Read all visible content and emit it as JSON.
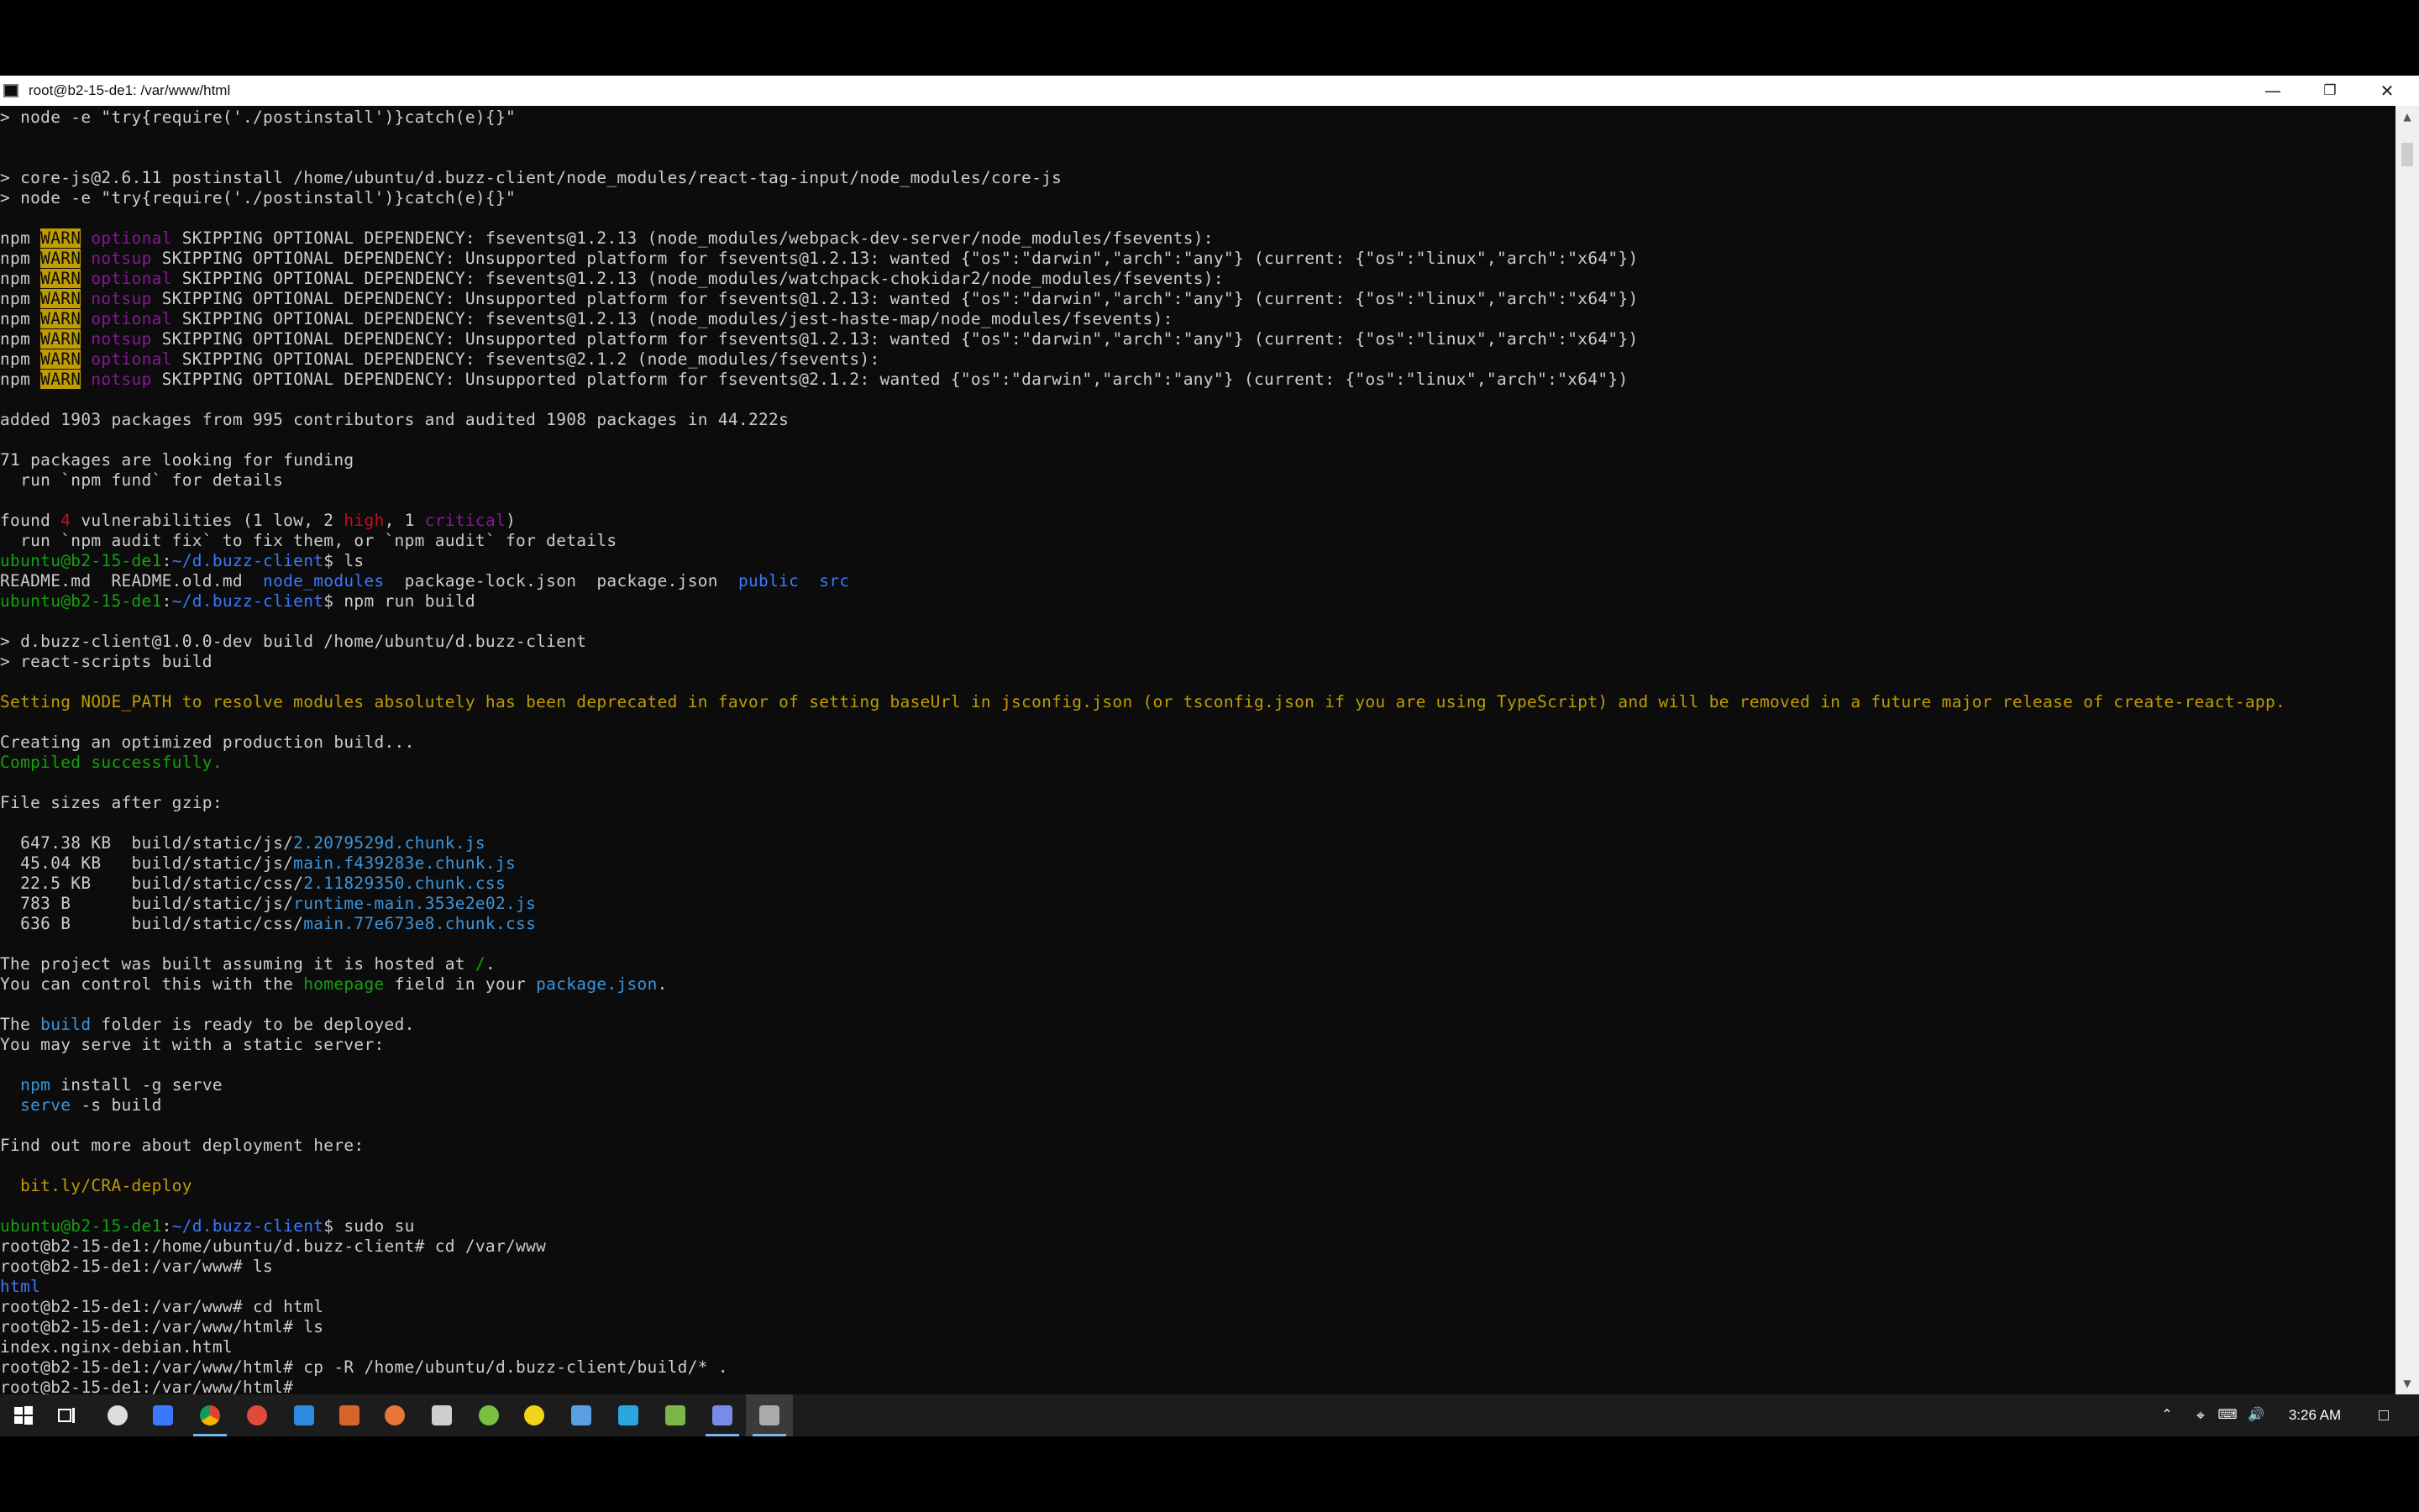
{
  "window": {
    "title": "root@b2-15-de1: /var/www/html",
    "icon": "terminal-icon"
  },
  "colors": {
    "default": "#cccccc",
    "warn_bg": "#c19c00",
    "warn_fg": "#0c0c0c",
    "optional": "#881798",
    "notsup": "#881798",
    "blue": "#3b78ff",
    "green": "#13a10e",
    "yellow": "#c19c00",
    "red": "#c50f1f",
    "cyan": "#3a96dd"
  },
  "terminal": {
    "lines": [
      [
        [
          "> node -e \"try{require('./postinstall')}catch(e){}\"",
          "d"
        ]
      ],
      [
        [
          "",
          "d"
        ]
      ],
      [
        [
          "",
          "d"
        ]
      ],
      [
        [
          "> core-js@2.6.11 postinstall /home/ubuntu/d.buzz-client/node_modules/react-tag-input/node_modules/core-js",
          "d"
        ]
      ],
      [
        [
          "> node -e \"try{require('./postinstall')}catch(e){}\"",
          "d"
        ]
      ],
      [
        [
          "",
          "d"
        ]
      ],
      [
        [
          "npm ",
          "d"
        ],
        [
          "WARN",
          "warn"
        ],
        [
          " ",
          "d"
        ],
        [
          "optional",
          "opt"
        ],
        [
          " SKIPPING OPTIONAL DEPENDENCY: fsevents@1.2.13 (node_modules/webpack-dev-server/node_modules/fsevents):",
          "d"
        ]
      ],
      [
        [
          "npm ",
          "d"
        ],
        [
          "WARN",
          "warn"
        ],
        [
          " ",
          "d"
        ],
        [
          "notsup",
          "opt"
        ],
        [
          " SKIPPING OPTIONAL DEPENDENCY: Unsupported platform for fsevents@1.2.13: wanted {\"os\":\"darwin\",\"arch\":\"any\"} (current: {\"os\":\"linux\",\"arch\":\"x64\"})",
          "d"
        ]
      ],
      [
        [
          "npm ",
          "d"
        ],
        [
          "WARN",
          "warn"
        ],
        [
          " ",
          "d"
        ],
        [
          "optional",
          "opt"
        ],
        [
          " SKIPPING OPTIONAL DEPENDENCY: fsevents@1.2.13 (node_modules/watchpack-chokidar2/node_modules/fsevents):",
          "d"
        ]
      ],
      [
        [
          "npm ",
          "d"
        ],
        [
          "WARN",
          "warn"
        ],
        [
          " ",
          "d"
        ],
        [
          "notsup",
          "opt"
        ],
        [
          " SKIPPING OPTIONAL DEPENDENCY: Unsupported platform for fsevents@1.2.13: wanted {\"os\":\"darwin\",\"arch\":\"any\"} (current: {\"os\":\"linux\",\"arch\":\"x64\"})",
          "d"
        ]
      ],
      [
        [
          "npm ",
          "d"
        ],
        [
          "WARN",
          "warn"
        ],
        [
          " ",
          "d"
        ],
        [
          "optional",
          "opt"
        ],
        [
          " SKIPPING OPTIONAL DEPENDENCY: fsevents@1.2.13 (node_modules/jest-haste-map/node_modules/fsevents):",
          "d"
        ]
      ],
      [
        [
          "npm ",
          "d"
        ],
        [
          "WARN",
          "warn"
        ],
        [
          " ",
          "d"
        ],
        [
          "notsup",
          "opt"
        ],
        [
          " SKIPPING OPTIONAL DEPENDENCY: Unsupported platform for fsevents@1.2.13: wanted {\"os\":\"darwin\",\"arch\":\"any\"} (current: {\"os\":\"linux\",\"arch\":\"x64\"})",
          "d"
        ]
      ],
      [
        [
          "npm ",
          "d"
        ],
        [
          "WARN",
          "warn"
        ],
        [
          " ",
          "d"
        ],
        [
          "optional",
          "opt"
        ],
        [
          " SKIPPING OPTIONAL DEPENDENCY: fsevents@2.1.2 (node_modules/fsevents):",
          "d"
        ]
      ],
      [
        [
          "npm ",
          "d"
        ],
        [
          "WARN",
          "warn"
        ],
        [
          " ",
          "d"
        ],
        [
          "notsup",
          "opt"
        ],
        [
          " SKIPPING OPTIONAL DEPENDENCY: Unsupported platform for fsevents@2.1.2: wanted {\"os\":\"darwin\",\"arch\":\"any\"} (current: {\"os\":\"linux\",\"arch\":\"x64\"})",
          "d"
        ]
      ],
      [
        [
          "",
          "d"
        ]
      ],
      [
        [
          "added 1903 packages from 995 contributors and audited 1908 packages in 44.222s",
          "d"
        ]
      ],
      [
        [
          "",
          "d"
        ]
      ],
      [
        [
          "71 packages are looking for funding",
          "d"
        ]
      ],
      [
        [
          "  run `npm fund` for details",
          "d"
        ]
      ],
      [
        [
          "",
          "d"
        ]
      ],
      [
        [
          "found ",
          "d"
        ],
        [
          "4",
          "red"
        ],
        [
          " vulnerabilities (1 low, 2 ",
          "d"
        ],
        [
          "high",
          "red"
        ],
        [
          ", 1 ",
          "d"
        ],
        [
          "critical",
          "opt"
        ],
        [
          ")",
          "d"
        ]
      ],
      [
        [
          "  run `npm audit fix` to fix them, or `npm audit` for details",
          "d"
        ]
      ],
      [
        [
          "ubuntu@b2-15-de1",
          "green"
        ],
        [
          ":",
          "d"
        ],
        [
          "~/d.buzz-client",
          "blue"
        ],
        [
          "$ ls",
          "d"
        ]
      ],
      [
        [
          "README.md  README.old.md  ",
          "d"
        ],
        [
          "node_modules",
          "blue"
        ],
        [
          "  package-lock.json  package.json  ",
          "d"
        ],
        [
          "public",
          "blue"
        ],
        [
          "  ",
          "d"
        ],
        [
          "src",
          "blue"
        ]
      ],
      [
        [
          "ubuntu@b2-15-de1",
          "green"
        ],
        [
          ":",
          "d"
        ],
        [
          "~/d.buzz-client",
          "blue"
        ],
        [
          "$ npm run build",
          "d"
        ]
      ],
      [
        [
          "",
          "d"
        ]
      ],
      [
        [
          "> d.buzz-client@1.0.0-dev build /home/ubuntu/d.buzz-client",
          "d"
        ]
      ],
      [
        [
          "> react-scripts build",
          "d"
        ]
      ],
      [
        [
          "",
          "d"
        ]
      ],
      [
        [
          "Setting NODE_PATH to resolve modules absolutely has been deprecated in favor of setting baseUrl in jsconfig.json (or tsconfig.json if you are using TypeScript) and will be removed in a future major release of create-react-app.",
          "yellow"
        ]
      ],
      [
        [
          "",
          "d"
        ]
      ],
      [
        [
          "Creating an optimized production build...",
          "d"
        ]
      ],
      [
        [
          "Compiled successfully.",
          "green"
        ]
      ],
      [
        [
          "",
          "d"
        ]
      ],
      [
        [
          "File sizes after gzip:",
          "d"
        ]
      ],
      [
        [
          "",
          "d"
        ]
      ],
      [
        [
          "  647.38 KB  build/static/js/",
          "d"
        ],
        [
          "2.2079529d.chunk.js",
          "cyan"
        ]
      ],
      [
        [
          "  45.04 KB   build/static/js/",
          "d"
        ],
        [
          "main.f439283e.chunk.js",
          "cyan"
        ]
      ],
      [
        [
          "  22.5 KB    build/static/css/",
          "d"
        ],
        [
          "2.11829350.chunk.css",
          "cyan"
        ]
      ],
      [
        [
          "  783 B      build/static/js/",
          "d"
        ],
        [
          "runtime-main.353e2e02.js",
          "cyan"
        ]
      ],
      [
        [
          "  636 B      build/static/css/",
          "d"
        ],
        [
          "main.77e673e8.chunk.css",
          "cyan"
        ]
      ],
      [
        [
          "",
          "d"
        ]
      ],
      [
        [
          "The project was built assuming it is hosted at ",
          "d"
        ],
        [
          "/",
          "green"
        ],
        [
          ".",
          "d"
        ]
      ],
      [
        [
          "You can control this with the ",
          "d"
        ],
        [
          "homepage",
          "green"
        ],
        [
          " field in your ",
          "d"
        ],
        [
          "package.json",
          "cyan"
        ],
        [
          ".",
          "d"
        ]
      ],
      [
        [
          "",
          "d"
        ]
      ],
      [
        [
          "The ",
          "d"
        ],
        [
          "build",
          "cyan"
        ],
        [
          " folder is ready to be deployed.",
          "d"
        ]
      ],
      [
        [
          "You may serve it with a static server:",
          "d"
        ]
      ],
      [
        [
          "",
          "d"
        ]
      ],
      [
        [
          "  ",
          "d"
        ],
        [
          "npm",
          "cyan"
        ],
        [
          " install -g serve",
          "d"
        ]
      ],
      [
        [
          "  ",
          "d"
        ],
        [
          "serve",
          "cyan"
        ],
        [
          " -s build",
          "d"
        ]
      ],
      [
        [
          "",
          "d"
        ]
      ],
      [
        [
          "Find out more about deployment here:",
          "d"
        ]
      ],
      [
        [
          "",
          "d"
        ]
      ],
      [
        [
          "  bit.ly/CRA-deploy",
          "yellow"
        ]
      ],
      [
        [
          "",
          "d"
        ]
      ],
      [
        [
          "ubuntu@b2-15-de1",
          "green"
        ],
        [
          ":",
          "d"
        ],
        [
          "~/d.buzz-client",
          "blue"
        ],
        [
          "$ sudo su",
          "d"
        ]
      ],
      [
        [
          "root@b2-15-de1:/home/ubuntu/d.buzz-client# cd /var/www",
          "d"
        ]
      ],
      [
        [
          "root@b2-15-de1:/var/www# ls",
          "d"
        ]
      ],
      [
        [
          "html",
          "blue"
        ]
      ],
      [
        [
          "root@b2-15-de1:/var/www# cd html",
          "d"
        ]
      ],
      [
        [
          "root@b2-15-de1:/var/www/html# ls",
          "d"
        ]
      ],
      [
        [
          "index.nginx-debian.html",
          "d"
        ]
      ],
      [
        [
          "root@b2-15-de1:/var/www/html# cp -R /home/ubuntu/d.buzz-client/build/* .",
          "d"
        ]
      ],
      [
        [
          "root@b2-15-de1:/var/www/html# ",
          "d"
        ],
        [
          "_",
          "d"
        ]
      ]
    ]
  },
  "taskbar": {
    "apps": [
      {
        "name": "start-button",
        "icon": "windows-logo-icon",
        "color": "#ffffff"
      },
      {
        "name": "task-view-button",
        "icon": "task-view-icon",
        "color": "#ffffff"
      },
      {
        "name": "taskbar-app-1",
        "icon": "circle-app-icon",
        "color": "#dddddd"
      },
      {
        "name": "taskbar-app-2",
        "icon": "notes-icon",
        "color": "#3b78ff"
      },
      {
        "name": "taskbar-app-chrome",
        "icon": "chrome-icon",
        "color": "#e8b100"
      },
      {
        "name": "taskbar-app-4",
        "icon": "browser-icon",
        "color": "#e04a3a"
      },
      {
        "name": "taskbar-app-vscode",
        "icon": "vscode-icon",
        "color": "#2a8be0"
      },
      {
        "name": "taskbar-app-6",
        "icon": "filezilla-icon",
        "color": "#d9642a"
      },
      {
        "name": "taskbar-app-7",
        "icon": "tool-icon",
        "color": "#e8743a"
      },
      {
        "name": "taskbar-app-8",
        "icon": "music-icon",
        "color": "#cfcfcf"
      },
      {
        "name": "taskbar-app-9",
        "icon": "smile-icon",
        "color": "#7bc043"
      },
      {
        "name": "taskbar-app-10",
        "icon": "app-icon",
        "color": "#f2d31b"
      },
      {
        "name": "taskbar-app-11",
        "icon": "window-icon",
        "color": "#5aa0e0"
      },
      {
        "name": "taskbar-app-telegram",
        "icon": "telegram-icon",
        "color": "#2ca5e0"
      },
      {
        "name": "taskbar-app-excel",
        "icon": "excel-icon",
        "color": "#7ab648"
      },
      {
        "name": "taskbar-app-15",
        "icon": "window-icon",
        "color": "#7a8ae8"
      },
      {
        "name": "taskbar-app-terminal",
        "icon": "terminal-icon",
        "color": "#aaaaaa"
      }
    ],
    "tray": {
      "time": "3:26 AM"
    }
  }
}
